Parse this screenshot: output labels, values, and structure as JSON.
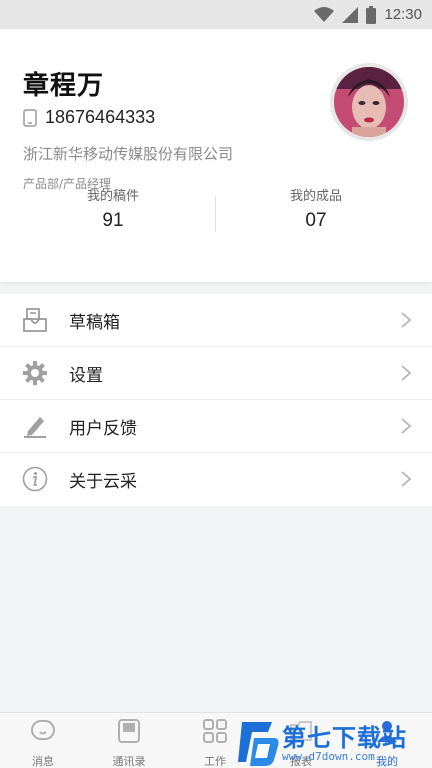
{
  "status_bar": {
    "time": "12:30"
  },
  "profile": {
    "name": "章程万",
    "phone": "18676464333",
    "company": "浙江新华移动传媒股份有限公司",
    "position": "产品部/产品经理",
    "stats": [
      {
        "label": "我的稿件",
        "value": "91"
      },
      {
        "label": "我的成品",
        "value": "07"
      }
    ]
  },
  "menu": {
    "items": [
      {
        "label": "草稿箱",
        "icon": "drafts-icon"
      },
      {
        "label": "设置",
        "icon": "gear-icon"
      },
      {
        "label": "用户反馈",
        "icon": "feedback-pen-icon"
      },
      {
        "label": "关于云采",
        "icon": "info-icon"
      }
    ]
  },
  "tabbar": {
    "tabs": [
      {
        "label": "消息",
        "icon": "message-icon",
        "active": false
      },
      {
        "label": "通讯录",
        "icon": "contacts-icon",
        "active": false
      },
      {
        "label": "工作",
        "icon": "grid-icon",
        "active": false
      },
      {
        "label": "报表",
        "icon": "report-icon",
        "active": false
      },
      {
        "label": "我的",
        "icon": "person-icon",
        "active": true
      }
    ]
  },
  "watermark": {
    "title": "第七下载站",
    "url": "www.d7down.com"
  },
  "colors": {
    "accent": "#2b6bd9",
    "background": "#f2f3f5",
    "card": "#ffffff",
    "secondary_text": "#8a8a8a"
  }
}
